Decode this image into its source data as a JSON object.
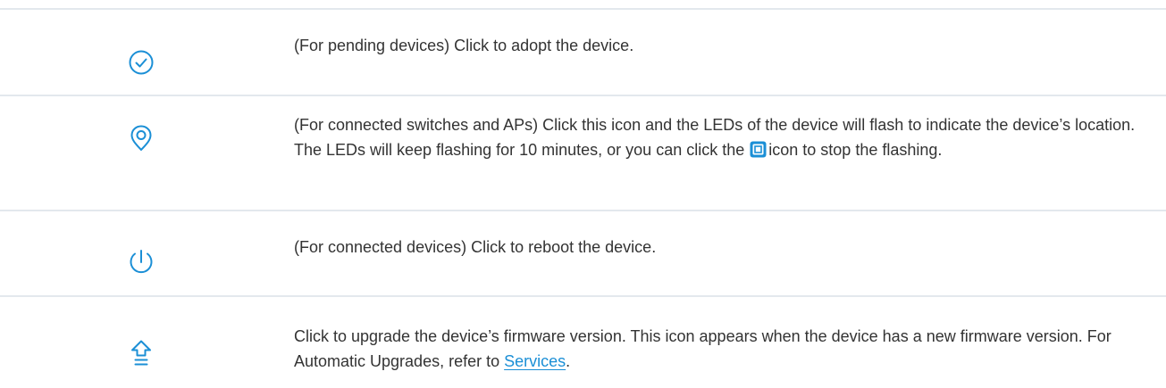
{
  "colors": {
    "icon_blue": "#1b8fd6",
    "divider": "#e3e8ed",
    "text": "#333333",
    "link": "#1b8fd6"
  },
  "rows": [
    {
      "icon": "check-circle-icon",
      "text": "(For pending devices) Click to adopt the device."
    },
    {
      "icon": "locate-pin-icon",
      "text_before": "(For connected switches and APs) Click this icon and the LEDs of the device will flash to indicate the device’s location. The LEDs will keep flashing for 10 minutes, or you can click the",
      "inline_icon": "stop-flashing-icon",
      "text_after": "icon to stop the flashing."
    },
    {
      "icon": "power-icon",
      "text": "(For connected devices) Click to reboot the device."
    },
    {
      "icon": "upgrade-arrow-icon",
      "text_before": "Click to upgrade the device’s firmware version. This icon appears when the device has a new firmware version. For Automatic Upgrades, refer to",
      "link_text": "Services",
      "text_after": "."
    }
  ]
}
